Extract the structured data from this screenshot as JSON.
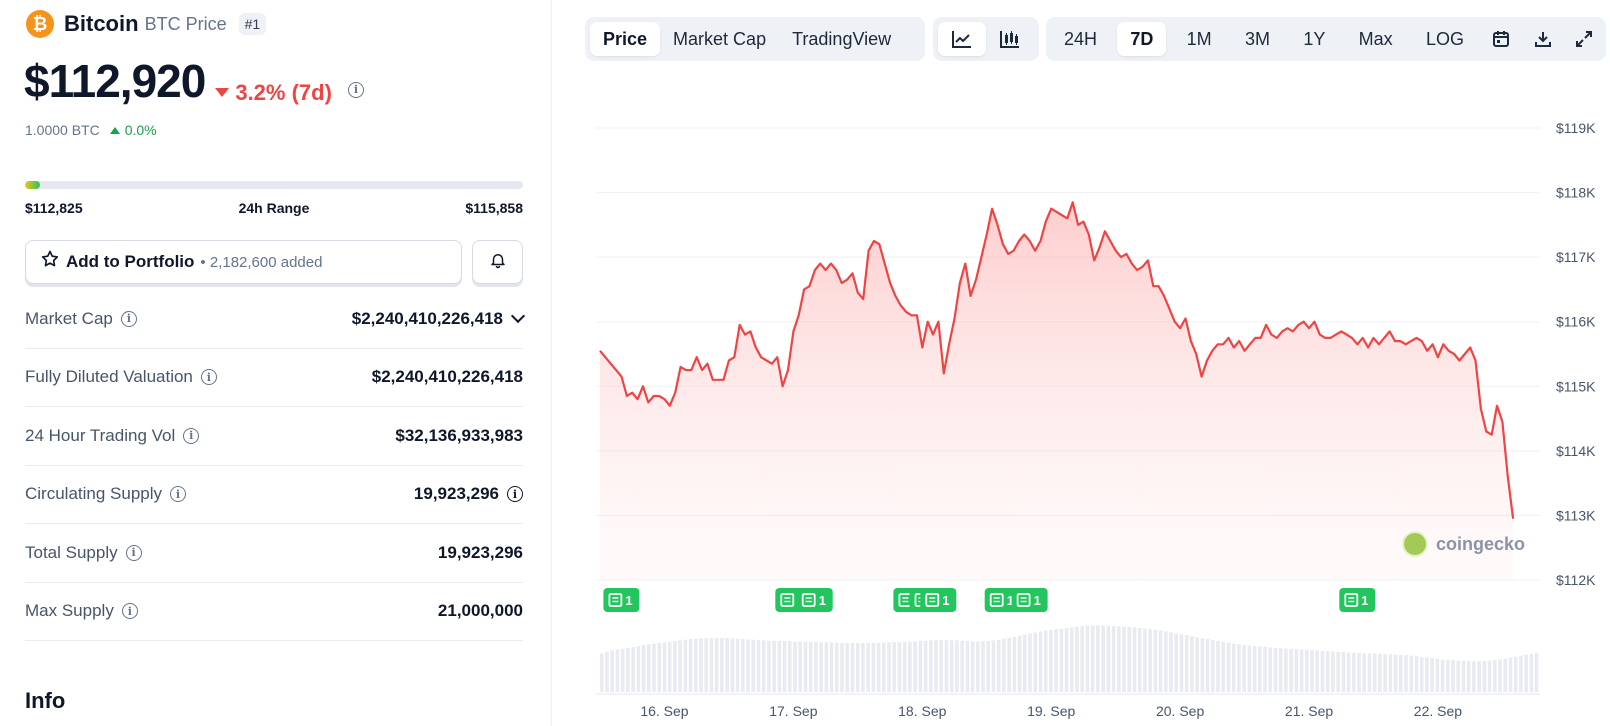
{
  "coin": {
    "name": "Bitcoin",
    "symbol_label": "BTC Price",
    "rank": "#1",
    "logo_glyph": "₿",
    "price": "$112,920",
    "change_7d": "3.2% (7d)",
    "btc_amount": "1.0000 BTC",
    "btc_change": "0.0%"
  },
  "range": {
    "low": "$112,825",
    "label": "24h Range",
    "high": "$115,858",
    "fill_fraction": 0.03
  },
  "portfolio": {
    "button_label": "Add to Portfolio",
    "added_text": "• 2,182,600 added"
  },
  "stats": [
    {
      "label": "Market Cap",
      "value": "$2,240,410,226,418"
    },
    {
      "label": "Fully Diluted Valuation",
      "value": "$2,240,410,226,418"
    },
    {
      "label": "24 Hour Trading Vol",
      "value": "$32,136,933,983"
    },
    {
      "label": "Circulating Supply",
      "value": "19,923,296"
    },
    {
      "label": "Total Supply",
      "value": "19,923,296"
    },
    {
      "label": "Max Supply",
      "value": "21,000,000"
    }
  ],
  "info_title": "Info",
  "toolbar": {
    "tabs": [
      "Price",
      "Market Cap",
      "TradingView"
    ],
    "active_tab": "Price",
    "chart_types": [
      "line-chart-icon",
      "candlestick-icon"
    ],
    "ranges": [
      "24H",
      "7D",
      "1M",
      "3M",
      "1Y",
      "Max",
      "LOG"
    ],
    "active_range": "7D",
    "tools": [
      "calendar-icon",
      "download-icon",
      "fullscreen-icon"
    ]
  },
  "watermark": "coingecko",
  "news_badge_count": "1",
  "colors": {
    "line": "#ef4444",
    "negative": "#ef4444",
    "positive": "#16a34a",
    "news": "#22c55e"
  },
  "chart_data": {
    "type": "area",
    "y_unit": "USD",
    "ylim": [
      112000,
      119000
    ],
    "y_ticks": [
      112000,
      113000,
      114000,
      115000,
      116000,
      117000,
      118000,
      119000
    ],
    "y_tick_labels": [
      "$112K",
      "$113K",
      "$114K",
      "$115K",
      "$116K",
      "$117K",
      "$118K",
      "$119K"
    ],
    "x_range": [
      "2025-09-15T12:00",
      "2025-09-22T19:00"
    ],
    "x_ticks": [
      "2025-09-16",
      "2025-09-17",
      "2025-09-18",
      "2025-09-19",
      "2025-09-20",
      "2025-09-21",
      "2025-09-22"
    ],
    "x_tick_labels": [
      "16. Sep",
      "17. Sep",
      "18. Sep",
      "19. Sep",
      "20. Sep",
      "21. Sep",
      "22. Sep"
    ],
    "grid": true,
    "series": [
      {
        "values": [
          [
            "2025-09-15T12:00",
            115550
          ],
          [
            "2025-09-15T16:00",
            115150
          ],
          [
            "2025-09-15T17:00",
            114850
          ],
          [
            "2025-09-15T18:00",
            114900
          ],
          [
            "2025-09-15T19:00",
            114800
          ],
          [
            "2025-09-15T20:00",
            115000
          ],
          [
            "2025-09-15T21:00",
            114750
          ],
          [
            "2025-09-15T22:00",
            114850
          ],
          [
            "2025-09-15T23:00",
            114850
          ],
          [
            "2025-09-16T00:00",
            114800
          ],
          [
            "2025-09-16T01:00",
            114700
          ],
          [
            "2025-09-16T02:00",
            114900
          ],
          [
            "2025-09-16T03:00",
            115300
          ],
          [
            "2025-09-16T04:00",
            115250
          ],
          [
            "2025-09-16T05:00",
            115250
          ],
          [
            "2025-09-16T06:00",
            115450
          ],
          [
            "2025-09-16T07:00",
            115250
          ],
          [
            "2025-09-16T08:00",
            115350
          ],
          [
            "2025-09-16T09:00",
            115100
          ],
          [
            "2025-09-16T10:00",
            115100
          ],
          [
            "2025-09-16T11:00",
            115100
          ],
          [
            "2025-09-16T12:00",
            115400
          ],
          [
            "2025-09-16T13:00",
            115450
          ],
          [
            "2025-09-16T14:00",
            115950
          ],
          [
            "2025-09-16T15:00",
            115800
          ],
          [
            "2025-09-16T16:00",
            115850
          ],
          [
            "2025-09-16T17:00",
            115600
          ],
          [
            "2025-09-16T18:00",
            115450
          ],
          [
            "2025-09-16T19:00",
            115400
          ],
          [
            "2025-09-16T20:00",
            115350
          ],
          [
            "2025-09-16T21:00",
            115450
          ],
          [
            "2025-09-16T22:00",
            115000
          ],
          [
            "2025-09-16T23:00",
            115250
          ],
          [
            "2025-09-17T00:00",
            115850
          ],
          [
            "2025-09-17T01:00",
            116100
          ],
          [
            "2025-09-17T02:00",
            116500
          ],
          [
            "2025-09-17T03:00",
            116550
          ],
          [
            "2025-09-17T04:00",
            116800
          ],
          [
            "2025-09-17T05:00",
            116900
          ],
          [
            "2025-09-17T06:00",
            116800
          ],
          [
            "2025-09-17T07:00",
            116900
          ],
          [
            "2025-09-17T08:00",
            116800
          ],
          [
            "2025-09-17T09:00",
            116600
          ],
          [
            "2025-09-17T10:00",
            116650
          ],
          [
            "2025-09-17T11:00",
            116750
          ],
          [
            "2025-09-17T12:00",
            116450
          ],
          [
            "2025-09-17T13:00",
            116350
          ],
          [
            "2025-09-17T14:00",
            117100
          ],
          [
            "2025-09-17T15:00",
            117250
          ],
          [
            "2025-09-17T16:00",
            117200
          ],
          [
            "2025-09-17T17:00",
            116900
          ],
          [
            "2025-09-17T18:00",
            116600
          ],
          [
            "2025-09-17T19:00",
            116400
          ],
          [
            "2025-09-17T20:00",
            116250
          ],
          [
            "2025-09-17T21:00",
            116150
          ],
          [
            "2025-09-17T22:00",
            116100
          ],
          [
            "2025-09-17T23:00",
            116100
          ],
          [
            "2025-09-18T00:00",
            115600
          ],
          [
            "2025-09-18T01:00",
            116000
          ],
          [
            "2025-09-18T02:00",
            115800
          ],
          [
            "2025-09-18T03:00",
            116000
          ],
          [
            "2025-09-18T04:00",
            115200
          ],
          [
            "2025-09-18T05:00",
            115650
          ],
          [
            "2025-09-18T06:00",
            116050
          ],
          [
            "2025-09-18T07:00",
            116600
          ],
          [
            "2025-09-18T08:00",
            116900
          ],
          [
            "2025-09-18T09:00",
            116400
          ],
          [
            "2025-09-18T10:00",
            116650
          ],
          [
            "2025-09-18T11:00",
            117000
          ],
          [
            "2025-09-18T12:00",
            117350
          ],
          [
            "2025-09-18T13:00",
            117750
          ],
          [
            "2025-09-18T14:00",
            117500
          ],
          [
            "2025-09-18T15:00",
            117200
          ],
          [
            "2025-09-18T16:00",
            117050
          ],
          [
            "2025-09-18T17:00",
            117100
          ],
          [
            "2025-09-18T18:00",
            117250
          ],
          [
            "2025-09-18T19:00",
            117350
          ],
          [
            "2025-09-18T20:00",
            117250
          ],
          [
            "2025-09-18T21:00",
            117100
          ],
          [
            "2025-09-18T22:00",
            117250
          ],
          [
            "2025-09-18T23:00",
            117550
          ],
          [
            "2025-09-19T00:00",
            117750
          ],
          [
            "2025-09-19T01:00",
            117700
          ],
          [
            "2025-09-19T02:00",
            117650
          ],
          [
            "2025-09-19T03:00",
            117600
          ],
          [
            "2025-09-19T04:00",
            117850
          ],
          [
            "2025-09-19T05:00",
            117500
          ],
          [
            "2025-09-19T06:00",
            117550
          ],
          [
            "2025-09-19T07:00",
            117350
          ],
          [
            "2025-09-19T08:00",
            116950
          ],
          [
            "2025-09-19T09:00",
            117150
          ],
          [
            "2025-09-19T10:00",
            117400
          ],
          [
            "2025-09-19T11:00",
            117250
          ],
          [
            "2025-09-19T12:00",
            117100
          ],
          [
            "2025-09-19T13:00",
            117000
          ],
          [
            "2025-09-19T14:00",
            117050
          ],
          [
            "2025-09-19T15:00",
            116900
          ],
          [
            "2025-09-19T16:00",
            116800
          ],
          [
            "2025-09-19T17:00",
            116850
          ],
          [
            "2025-09-19T18:00",
            116950
          ],
          [
            "2025-09-19T19:00",
            116550
          ],
          [
            "2025-09-19T20:00",
            116550
          ],
          [
            "2025-09-19T21:00",
            116400
          ],
          [
            "2025-09-19T22:00",
            116200
          ],
          [
            "2025-09-19T23:00",
            116000
          ],
          [
            "2025-09-20T00:00",
            115900
          ],
          [
            "2025-09-20T01:00",
            116050
          ],
          [
            "2025-09-20T02:00",
            115700
          ],
          [
            "2025-09-20T03:00",
            115500
          ],
          [
            "2025-09-20T04:00",
            115150
          ],
          [
            "2025-09-20T05:00",
            115400
          ],
          [
            "2025-09-20T06:00",
            115550
          ],
          [
            "2025-09-20T07:00",
            115650
          ],
          [
            "2025-09-20T08:00",
            115650
          ],
          [
            "2025-09-20T09:00",
            115750
          ],
          [
            "2025-09-20T10:00",
            115600
          ],
          [
            "2025-09-20T11:00",
            115700
          ],
          [
            "2025-09-20T12:00",
            115550
          ],
          [
            "2025-09-20T13:00",
            115650
          ],
          [
            "2025-09-20T14:00",
            115750
          ],
          [
            "2025-09-20T15:00",
            115750
          ],
          [
            "2025-09-20T16:00",
            115950
          ],
          [
            "2025-09-20T17:00",
            115800
          ],
          [
            "2025-09-20T18:00",
            115750
          ],
          [
            "2025-09-20T19:00",
            115850
          ],
          [
            "2025-09-20T20:00",
            115900
          ],
          [
            "2025-09-20T21:00",
            115850
          ],
          [
            "2025-09-20T22:00",
            115950
          ],
          [
            "2025-09-20T23:00",
            116000
          ],
          [
            "2025-09-21T00:00",
            115900
          ],
          [
            "2025-09-21T01:00",
            116000
          ],
          [
            "2025-09-21T02:00",
            115800
          ],
          [
            "2025-09-21T03:00",
            115750
          ],
          [
            "2025-09-21T04:00",
            115750
          ],
          [
            "2025-09-21T05:00",
            115800
          ],
          [
            "2025-09-21T06:00",
            115850
          ],
          [
            "2025-09-21T07:00",
            115800
          ],
          [
            "2025-09-21T08:00",
            115750
          ],
          [
            "2025-09-21T09:00",
            115650
          ],
          [
            "2025-09-21T10:00",
            115750
          ],
          [
            "2025-09-21T11:00",
            115600
          ],
          [
            "2025-09-21T12:00",
            115750
          ],
          [
            "2025-09-21T13:00",
            115650
          ],
          [
            "2025-09-21T14:00",
            115750
          ],
          [
            "2025-09-21T15:00",
            115850
          ],
          [
            "2025-09-21T16:00",
            115700
          ],
          [
            "2025-09-21T17:00",
            115700
          ],
          [
            "2025-09-21T18:00",
            115650
          ],
          [
            "2025-09-21T19:00",
            115700
          ],
          [
            "2025-09-21T20:00",
            115750
          ],
          [
            "2025-09-21T21:00",
            115700
          ],
          [
            "2025-09-21T22:00",
            115550
          ],
          [
            "2025-09-21T23:00",
            115650
          ],
          [
            "2025-09-22T00:00",
            115450
          ],
          [
            "2025-09-22T01:00",
            115650
          ],
          [
            "2025-09-22T02:00",
            115550
          ],
          [
            "2025-09-22T03:00",
            115500
          ],
          [
            "2025-09-22T04:00",
            115400
          ],
          [
            "2025-09-22T05:00",
            115500
          ],
          [
            "2025-09-22T06:00",
            115600
          ],
          [
            "2025-09-22T07:00",
            115400
          ],
          [
            "2025-09-22T08:00",
            114650
          ],
          [
            "2025-09-22T09:00",
            114300
          ],
          [
            "2025-09-22T10:00",
            114250
          ],
          [
            "2025-09-22T11:00",
            114700
          ],
          [
            "2025-09-22T12:00",
            114450
          ],
          [
            "2025-09-22T13:00",
            113600
          ],
          [
            "2025-09-22T14:00",
            112950
          ]
        ]
      }
    ],
    "news_markers": [
      "2025-09-15T13:00",
      "2025-09-16T21:00",
      "2025-09-17T01:00",
      "2025-09-17T19:00",
      "2025-09-17T22:00",
      "2025-09-18T00:00",
      "2025-09-18T12:00",
      "2025-09-18T17:00",
      "2025-09-21T06:00"
    ],
    "volume_relative": [
      0.55,
      0.6,
      0.62,
      0.65,
      0.68,
      0.7,
      0.72,
      0.74,
      0.76,
      0.77,
      0.77,
      0.77,
      0.76,
      0.75,
      0.74,
      0.73,
      0.73,
      0.72,
      0.72,
      0.71,
      0.71,
      0.7,
      0.7,
      0.7,
      0.7,
      0.71,
      0.71,
      0.72,
      0.73,
      0.74,
      0.74,
      0.74,
      0.73,
      0.72,
      0.73,
      0.75,
      0.78,
      0.82,
      0.85,
      0.88,
      0.9,
      0.92,
      0.94,
      0.95,
      0.95,
      0.94,
      0.93,
      0.92,
      0.9,
      0.88,
      0.85,
      0.82,
      0.79,
      0.76,
      0.73,
      0.7,
      0.68,
      0.66,
      0.65,
      0.63,
      0.62,
      0.61,
      0.6,
      0.59,
      0.58,
      0.57,
      0.56,
      0.55,
      0.55,
      0.54,
      0.53,
      0.52,
      0.5,
      0.48,
      0.46,
      0.45,
      0.44,
      0.44,
      0.45,
      0.47,
      0.5,
      0.53,
      0.56
    ]
  }
}
